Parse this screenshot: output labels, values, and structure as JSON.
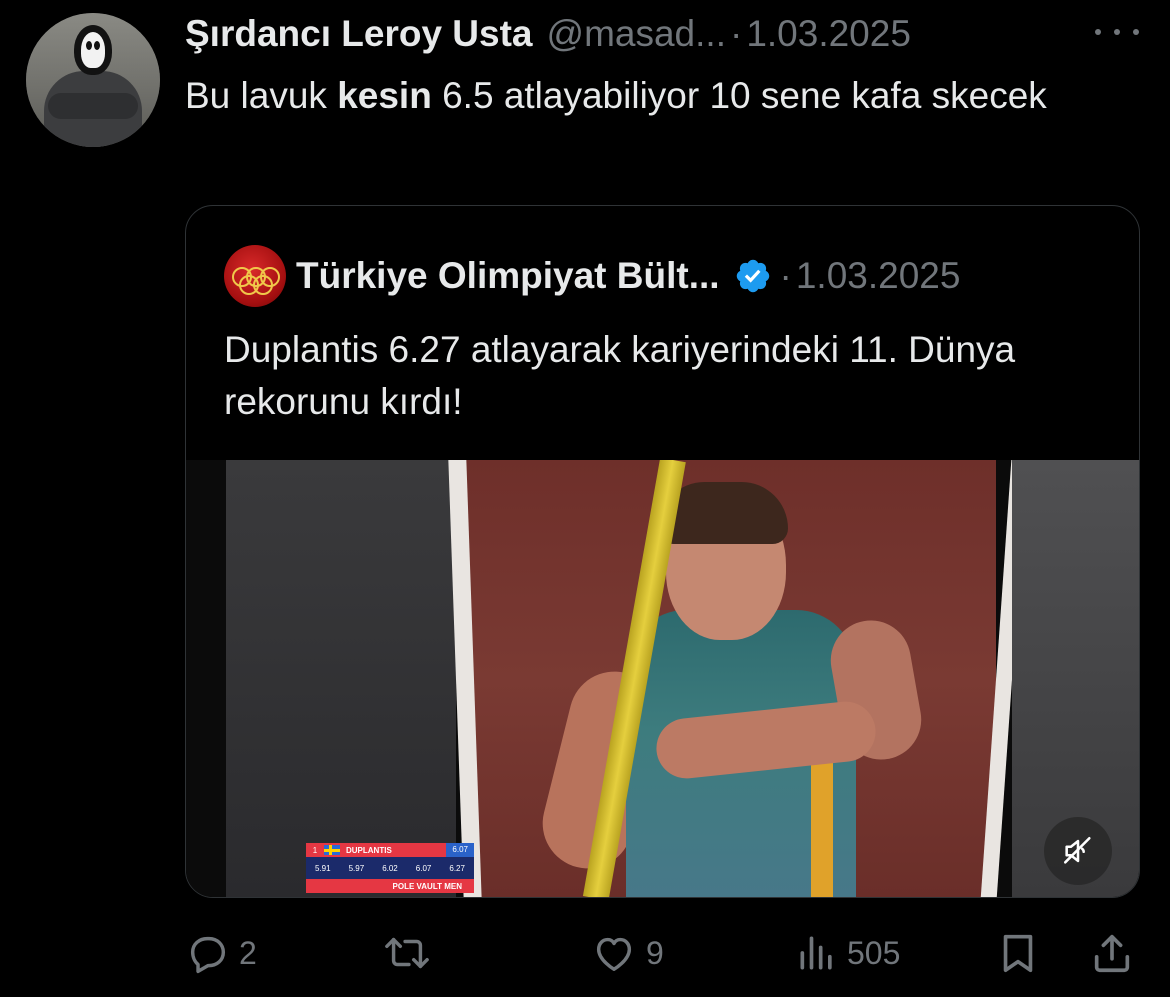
{
  "tweet": {
    "author_name": "Şırdancı Leroy Usta",
    "handle": "@masad...",
    "separator": "·",
    "date": "1.03.2025",
    "text_before": "Bu lavuk ",
    "text_bold": "kesin",
    "text_after": " 6.5 atlayabiliyor 10 sene kafa skecek"
  },
  "quote": {
    "author_name": "Türkiye Olimpiyat Bült...",
    "separator": "·",
    "date": "1.03.2025",
    "text": "Duplantis 6.27 atlayarak kariyerindeki 11. Dünya rekorunu kırdı!",
    "verified_color": "#1d9bf0"
  },
  "video": {
    "scoreboard": {
      "rank": "1",
      "athlete": "DUPLANTIS",
      "best": "6.07",
      "attempts": [
        "5.91",
        "5.97",
        "6.02",
        "6.07",
        "6.27"
      ],
      "event": "POLE VAULT MEN"
    },
    "muted_icon": "speaker-muted-icon"
  },
  "actions": {
    "replies": "2",
    "retweets": "",
    "likes": "9",
    "views": "505"
  },
  "colors": {
    "background": "#000000",
    "text": "#e7e9ea",
    "muted": "#71767b",
    "border": "#2f3336"
  }
}
